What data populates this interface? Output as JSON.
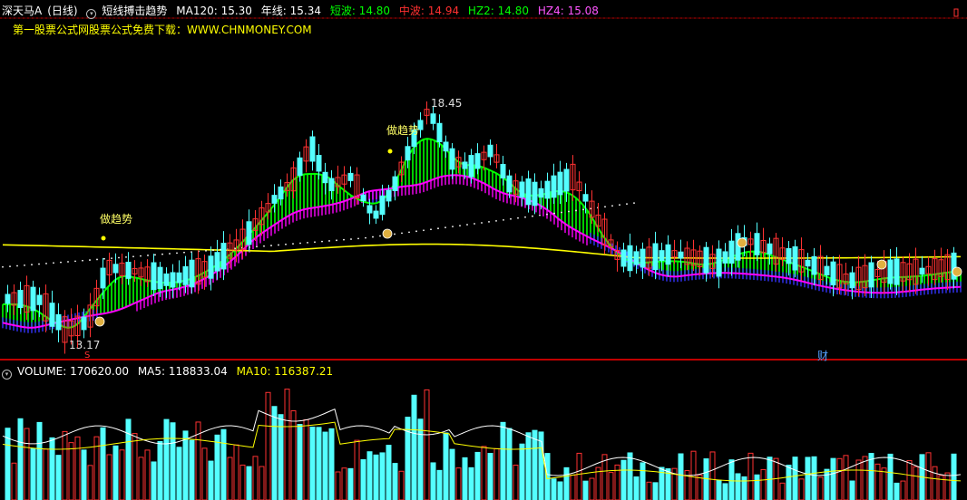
{
  "header": {
    "stock_name": "深天马A",
    "period": "(日线)",
    "indicator_name": "短线搏击趋势",
    "ma120": "MA120: 15.30",
    "year_line": "年线: 15.34",
    "short_wave": "短波: 14.80",
    "mid_wave": "中波: 14.94",
    "hz2": "HZ2: 14.80",
    "hz4": "HZ4: 15.08"
  },
  "promo_text": "第一股票公式网股票公式免费下载：WWW.CHNMONEY.COM",
  "annotations": {
    "price_high": "18.45",
    "price_low": "13.17",
    "trend_label_1": "做趋势",
    "trend_label_2": "做趋势",
    "low_marker": "S",
    "finance_marker": "财"
  },
  "volume_header": {
    "volume": "VOLUME: 170620.00",
    "ma5": "MA5: 118833.04",
    "ma10": "MA10: 116387.21"
  },
  "colors": {
    "bull": "#ff3232",
    "bear": "#54ffff",
    "short_wave": "#00ff00",
    "mid_wave": "#ff00ff",
    "hz_band": "#3333ff",
    "year_line": "#ffff00",
    "axis": "#c00000",
    "dotted": "#ffffff",
    "title_text": "#ffffff",
    "ma120_text": "#ffffff",
    "year_text": "#ffffff",
    "short_text": "#00ff00",
    "mid_text": "#ff3030",
    "hz2_text": "#00ff00",
    "hz4_text": "#ff55ff",
    "promo_text_color": "#ffff00",
    "vol_ma5": "#ffffff",
    "vol_ma10": "#ffff00"
  },
  "icons": [
    "dropdown-circle-icon",
    "money-bag-icon"
  ]
}
